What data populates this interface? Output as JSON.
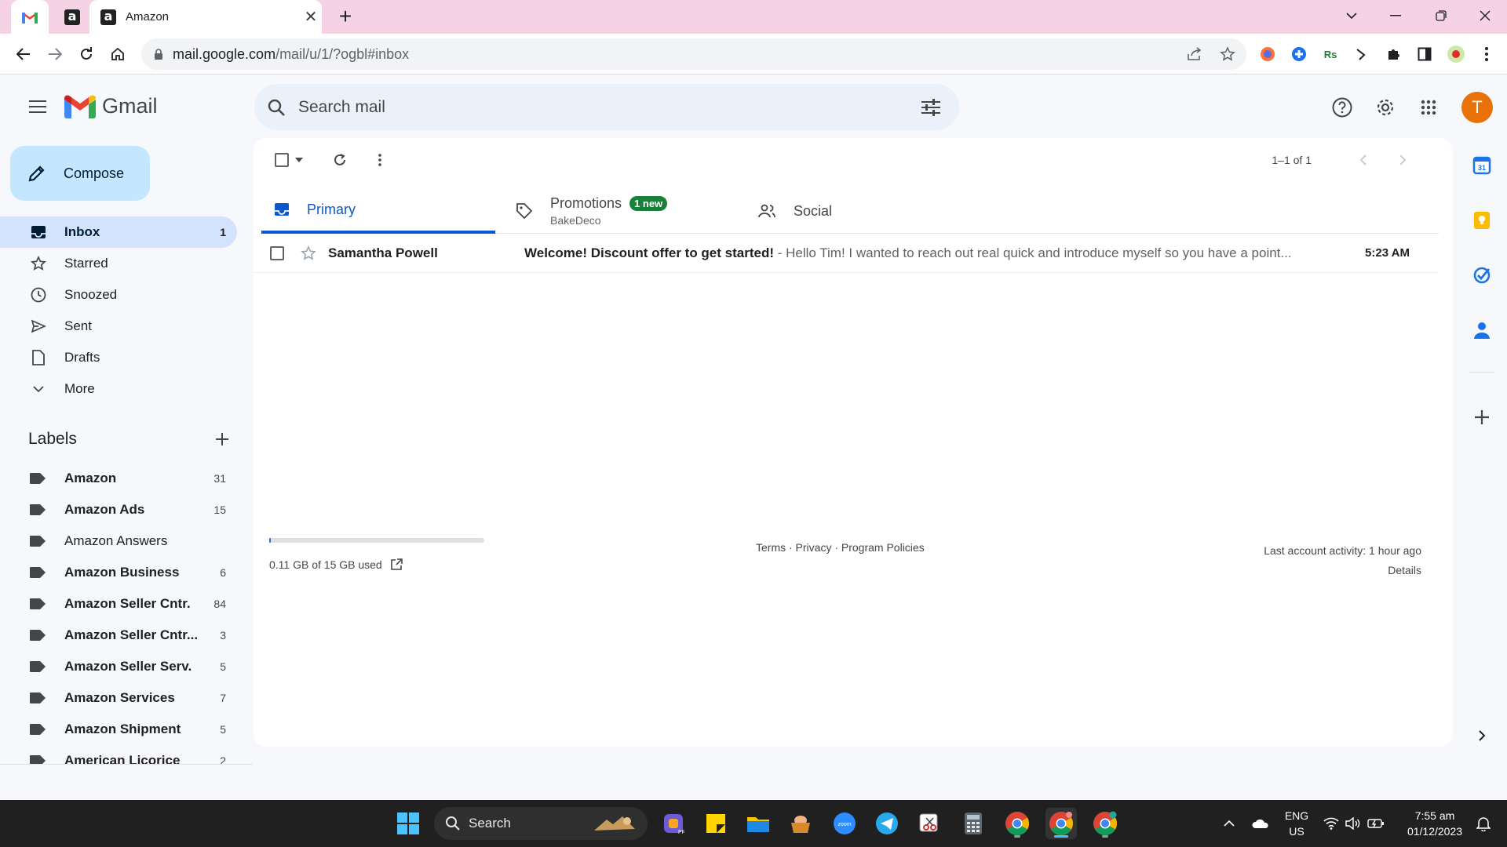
{
  "browser": {
    "tabs": [
      {
        "icon": "gmail-favicon",
        "title": ""
      },
      {
        "icon": "amazon-favicon",
        "title": ""
      },
      {
        "icon": "amazon-favicon",
        "title": "Amazon",
        "active": true
      }
    ],
    "address": {
      "host": "mail.google.com",
      "path": "/mail/u/1/?ogbl#inbox"
    }
  },
  "gmail": {
    "logo_text": "Gmail",
    "search_placeholder": "Search mail",
    "avatar_letter": "T",
    "compose_label": "Compose",
    "nav": [
      {
        "label": "Inbox",
        "count": "1",
        "icon": "inbox-icon",
        "active": true
      },
      {
        "label": "Starred",
        "count": "",
        "icon": "star-icon"
      },
      {
        "label": "Snoozed",
        "count": "",
        "icon": "clock-icon"
      },
      {
        "label": "Sent",
        "count": "",
        "icon": "send-icon"
      },
      {
        "label": "Drafts",
        "count": "",
        "icon": "draft-icon"
      },
      {
        "label": "More",
        "count": "",
        "icon": "chevron-down-icon"
      }
    ],
    "labels_title": "Labels",
    "labels": [
      {
        "name": "Amazon",
        "count": "31",
        "bold": true
      },
      {
        "name": "Amazon Ads",
        "count": "15",
        "bold": true
      },
      {
        "name": "Amazon Answers",
        "count": "",
        "bold": false
      },
      {
        "name": "Amazon Business",
        "count": "6",
        "bold": true
      },
      {
        "name": "Amazon Seller Cntr.",
        "count": "84",
        "bold": true
      },
      {
        "name": "Amazon Seller Cntr...",
        "count": "3",
        "bold": true
      },
      {
        "name": "Amazon Seller Serv.",
        "count": "5",
        "bold": true
      },
      {
        "name": "Amazon Services",
        "count": "7",
        "bold": true
      },
      {
        "name": "Amazon Shipment",
        "count": "5",
        "bold": true
      },
      {
        "name": "American Licorice",
        "count": "2",
        "bold": true
      }
    ],
    "pager": "1–1 of 1",
    "categories": [
      {
        "label": "Primary",
        "icon": "inbox-tab-icon",
        "active": true
      },
      {
        "label": "Promotions",
        "badge": "1 new",
        "sub": "BakeDeco",
        "icon": "tag-icon"
      },
      {
        "label": "Social",
        "icon": "people-icon"
      }
    ],
    "messages": [
      {
        "sender": "Samantha Powell",
        "subject": "Welcome! Discount offer to get started!",
        "snippet": " - Hello Tim! I wanted to reach out real quick and introduce myself so you have a point...",
        "time": "5:23 AM"
      }
    ],
    "footer": {
      "storage": "0.11 GB of 15 GB used",
      "storage_fraction": 0.007,
      "links": "Terms · Privacy · Program Policies",
      "activity": "Last account activity: 1 hour ago",
      "details": "Details"
    }
  },
  "taskbar": {
    "search_label": "Search",
    "lang": "ENG",
    "region": "US",
    "time": "7:55 am",
    "date": "01/12/2023"
  },
  "colors": {
    "accent": "#0b57d0",
    "compose_bg": "#c2e7ff",
    "active_nav": "#d3e3fd",
    "avatar": "#e8710a",
    "tab_strip": "#f5d3e4",
    "badge": "#188038"
  }
}
